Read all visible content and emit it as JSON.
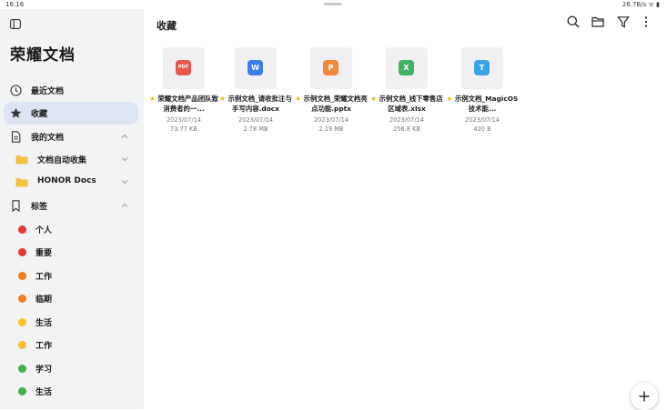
{
  "status_bar": {
    "time": "16:16",
    "system": "26.7B/s ᯤ ▮"
  },
  "sidebar": {
    "app_title": "荣耀文档",
    "nav": [
      {
        "label": "最近文档",
        "icon": "clock-icon"
      },
      {
        "label": "收藏",
        "icon": "star-icon",
        "active": true
      },
      {
        "label": "我的文档",
        "icon": "document-icon",
        "expanded": true
      }
    ],
    "folders": [
      {
        "label": "文档自动收集",
        "icon": "folder-icon"
      },
      {
        "label": "HONOR Docs",
        "icon": "folder-icon"
      }
    ],
    "tags_section": {
      "label": "标签",
      "icon": "bookmark-icon",
      "expanded": true
    },
    "tags": [
      {
        "label": "个人",
        "color": "#e53935"
      },
      {
        "label": "重要",
        "color": "#e53935"
      },
      {
        "label": "工作",
        "color": "#f57c1f"
      },
      {
        "label": "临期",
        "color": "#f57c1f"
      },
      {
        "label": "生活",
        "color": "#fbc02d"
      },
      {
        "label": "工作",
        "color": "#fbc02d"
      },
      {
        "label": "学习",
        "color": "#43b049"
      },
      {
        "label": "生活",
        "color": "#43b049"
      }
    ]
  },
  "main": {
    "title": "收藏",
    "toolbar": [
      "search-icon",
      "folder-open-icon",
      "filter-icon",
      "more-vertical-icon"
    ],
    "files": [
      {
        "type": "PDF",
        "color": "#e8584f",
        "name": "荣耀文档产品团队致消费者的一...",
        "date": "2023/07/14",
        "size": "73.77 KB"
      },
      {
        "type": "W",
        "color": "#3b7de9",
        "name": "示例文档_请收批注与手写内容.docx",
        "date": "2023/07/14",
        "size": "2.78 MB"
      },
      {
        "type": "P",
        "color": "#f0883e",
        "name": "示例文档_荣耀文档亮点功能.pptx",
        "date": "2023/07/14",
        "size": "2.19 MB"
      },
      {
        "type": "X",
        "color": "#3fb263",
        "name": "示例文档_线下零售店区域表.xlsx",
        "date": "2023/07/14",
        "size": "256.8 KB"
      },
      {
        "type": "T",
        "color": "#3aa4e8",
        "name": "示例文档_MagicOS技术能...",
        "date": "2023/07/14",
        "size": "420 B"
      }
    ],
    "fab": "plus-icon"
  }
}
